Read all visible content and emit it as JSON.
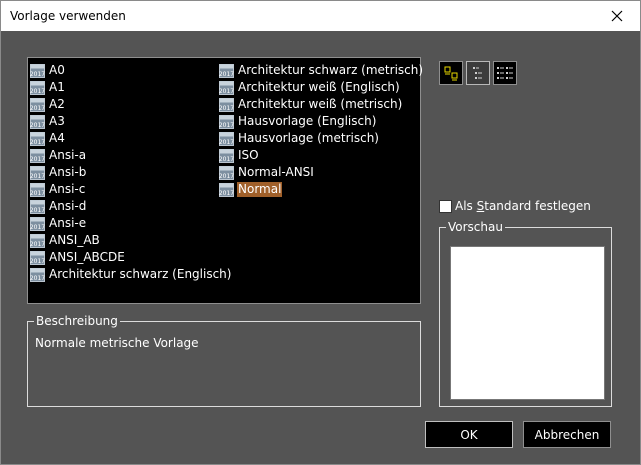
{
  "window": {
    "title": "Vorlage verwenden"
  },
  "template_list": {
    "column1": [
      {
        "label": "A0"
      },
      {
        "label": "A1"
      },
      {
        "label": "A2"
      },
      {
        "label": "A3"
      },
      {
        "label": "A4"
      },
      {
        "label": "Ansi-a"
      },
      {
        "label": "Ansi-b"
      },
      {
        "label": "Ansi-c"
      },
      {
        "label": "Ansi-d"
      },
      {
        "label": "Ansi-e"
      },
      {
        "label": "ANSI_AB"
      },
      {
        "label": "ANSI_ABCDE"
      },
      {
        "label": "Architektur schwarz (Englisch)"
      }
    ],
    "column2": [
      {
        "label": "Architektur schwarz (metrisch)"
      },
      {
        "label": "Architektur weiß (Englisch)"
      },
      {
        "label": "Architektur weiß (metrisch)"
      },
      {
        "label": "Hausvorlage (Englisch)"
      },
      {
        "label": "Hausvorlage (metrisch)"
      },
      {
        "label": "ISO"
      },
      {
        "label": "Normal-ANSI"
      },
      {
        "label": "Normal",
        "selected": true
      }
    ],
    "icon_badge": "2017"
  },
  "view_buttons": [
    "large-icons",
    "list",
    "details"
  ],
  "set_default": {
    "label_pre": "Als ",
    "label_accel": "S",
    "label_post": "tandard festlegen",
    "checked": false
  },
  "preview": {
    "label": "Vorschau"
  },
  "description": {
    "label": "Beschreibung",
    "text": "Normale metrische Vorlage"
  },
  "buttons": {
    "ok": "OK",
    "cancel": "Abbrechen"
  },
  "colors": {
    "background": "#545454",
    "selection": "#a0602a",
    "list_bg": "#000000"
  }
}
